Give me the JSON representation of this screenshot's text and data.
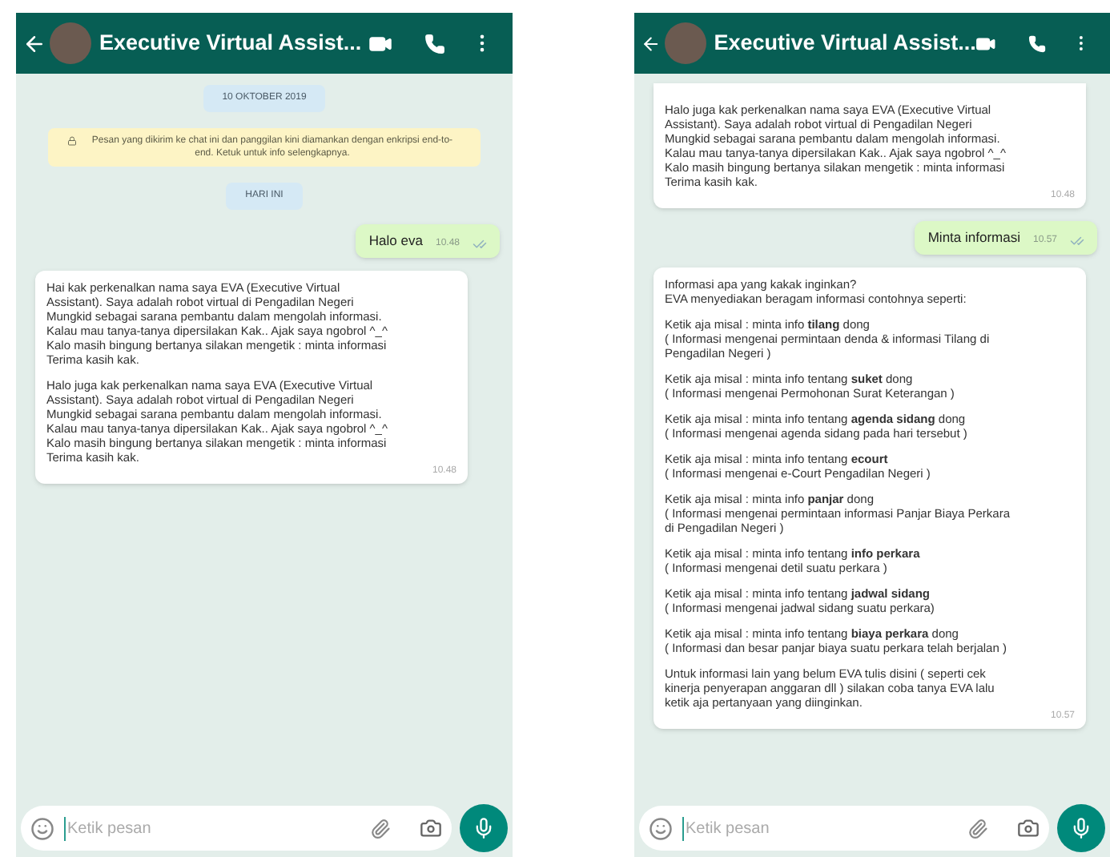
{
  "phones": [
    {
      "header": {
        "title": "Executive Virtual Assist..."
      },
      "messages": [
        {
          "kind": "date",
          "text": "10 OKTOBER 2019"
        },
        {
          "kind": "notice",
          "text": "Pesan yang dikirim ke chat ini dan panggilan kini diamankan dengan enkripsi end-to-end. Ketuk untuk info selengkapnya."
        },
        {
          "kind": "date",
          "text": "HARI INI"
        },
        {
          "kind": "sent",
          "text": "Halo eva",
          "time": "10.48"
        },
        {
          "kind": "received",
          "time": "10.48",
          "paragraphs": [
            [
              "Hai kak  perkenalkan nama saya EVA (Executive Virtual",
              "Assistant). Saya adalah robot virtual di Pengadilan Negeri",
              "Mungkid sebagai sarana pembantu dalam mengolah informasi.",
              "Kalau mau tanya-tanya dipersilakan Kak.. Ajak saya ngobrol ^_^",
              "Kalo masih bingung bertanya silakan mengetik : minta informasi",
              "Terima kasih kak."
            ],
            [
              "Halo juga kak  perkenalkan nama saya EVA (Executive Virtual",
              "Assistant). Saya adalah robot virtual di Pengadilan Negeri",
              "Mungkid sebagai sarana pembantu dalam mengolah informasi.",
              "Kalau mau tanya-tanya dipersilakan Kak.. Ajak saya ngobrol ^_^",
              "Kalo masih bingung bertanya silakan mengetik : minta informasi",
              "Terima kasih kak."
            ]
          ]
        }
      ],
      "composer": {
        "placeholder": "Ketik pesan"
      }
    },
    {
      "header": {
        "title": "Executive Virtual Assist..."
      },
      "messages": [
        {
          "kind": "received",
          "time": "10.48",
          "paragraphs": [
            [
              "Halo juga kak  perkenalkan nama saya EVA (Executive Virtual",
              "Assistant). Saya adalah robot virtual di Pengadilan Negeri",
              "Mungkid sebagai sarana pembantu dalam mengolah informasi.",
              "Kalau mau tanya-tanya dipersilakan Kak.. Ajak saya ngobrol ^_^",
              "Kalo masih bingung bertanya silakan mengetik : minta informasi",
              "Terima kasih kak."
            ]
          ]
        },
        {
          "kind": "sent",
          "text": "Minta informasi",
          "time": "10.57"
        },
        {
          "kind": "received",
          "time": "10.57",
          "paragraphs": [
            [
              "Informasi apa yang kakak inginkan?",
              "EVA menyediakan beragam informasi contohnya seperti:"
            ],
            [
              "Ketik aja misal : minta info **tilang** dong",
              "( Informasi mengenai permintaan denda & informasi Tilang di",
              "Pengadilan Negeri )"
            ],
            [
              "Ketik aja misal : minta info tentang **suket** dong",
              "( Informasi mengenai Permohonan Surat Keterangan )"
            ],
            [
              "Ketik aja misal : minta info tentang **agenda sidang** dong",
              "( Informasi mengenai agenda sidang pada hari tersebut )"
            ],
            [
              "Ketik aja misal : minta info tentang **ecourt**",
              "( Informasi mengenai e-Court Pengadilan Negeri )"
            ],
            [
              "Ketik aja misal : minta info **panjar** dong",
              "( Informasi mengenai permintaan informasi Panjar Biaya Perkara",
              "di Pengadilan Negeri )"
            ],
            [
              "Ketik aja misal : minta info tentang **info perkara**",
              "( Informasi mengenai detil suatu perkara )"
            ],
            [
              "Ketik aja misal : minta info tentang **jadwal sidang**",
              "( Informasi mengenai jadwal sidang suatu perkara)"
            ],
            [
              "Ketik aja misal : minta info tentang **biaya perkara** dong",
              "( Informasi dan besar panjar biaya suatu perkara telah berjalan )"
            ],
            [
              "Untuk informasi lain yang belum EVA tulis disini ( seperti cek",
              "kinerja  penyerapan anggaran dll ) silakan coba tanya EVA lalu",
              "ketik aja pertanyaan yang diinginkan."
            ]
          ]
        }
      ],
      "composer": {
        "placeholder": "Ketik pesan"
      }
    }
  ]
}
